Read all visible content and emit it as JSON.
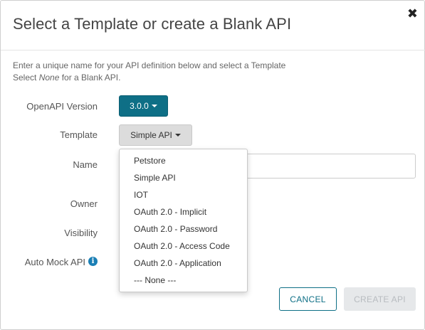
{
  "dialog": {
    "title": "Select a Template or create a Blank API",
    "close_glyph": "✖"
  },
  "intro": {
    "line1": "Enter a unique name for your API definition below and select a Template",
    "line2_prefix": "Select ",
    "line2_em": "None",
    "line2_suffix": " for a Blank API."
  },
  "form": {
    "openapi_label": "OpenAPI Version",
    "openapi_value": "3.0.0",
    "template_label": "Template",
    "template_value": "Simple API",
    "name_label": "Name",
    "name_value": "",
    "owner_label": "Owner",
    "visibility_label": "Visibility",
    "automock_label": "Auto Mock API",
    "info_icon_glyph": "i"
  },
  "template_dropdown": {
    "items": [
      "Petstore",
      "Simple API",
      "IOT",
      "OAuth 2.0 - Implicit",
      "OAuth 2.0 - Password",
      "OAuth 2.0 - Access Code",
      "OAuth 2.0 - Application",
      "--- None ---"
    ]
  },
  "footer": {
    "cancel_label": "CANCEL",
    "create_label": "CREATE API"
  },
  "colors": {
    "accent": "#0e6f86",
    "disabled_bg": "#e6e8ea",
    "disabled_text": "#b8bcc0",
    "info_icon": "#1a7fb5"
  }
}
